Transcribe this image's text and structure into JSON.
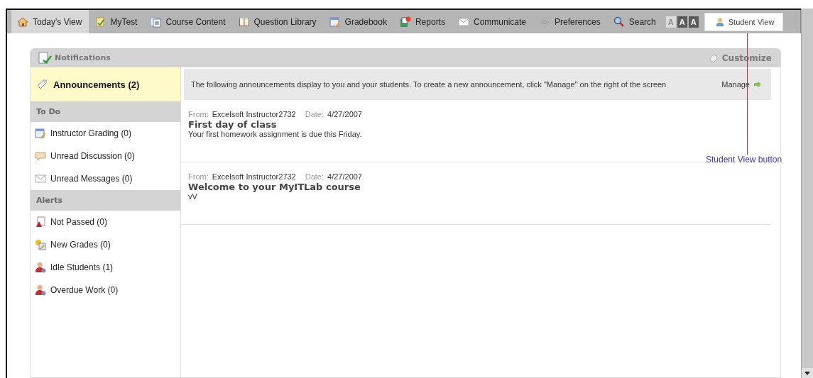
{
  "toolbar": {
    "tabs": [
      {
        "label": "Today's View",
        "selected": true
      },
      {
        "label": "MyTest",
        "selected": false
      },
      {
        "label": "Course Content",
        "selected": false
      },
      {
        "label": "Question Library",
        "selected": false
      },
      {
        "label": "Gradebook",
        "selected": false
      },
      {
        "label": "Reports",
        "selected": false
      },
      {
        "label": "Communicate",
        "selected": false
      },
      {
        "label": "Preferences",
        "selected": false
      },
      {
        "label": "Search",
        "selected": false
      }
    ],
    "text_sizes": [
      {
        "label": "A",
        "disabled": true
      },
      {
        "label": "A",
        "disabled": false
      },
      {
        "label": "A",
        "disabled": false
      }
    ],
    "student_view": {
      "label": "Student View"
    }
  },
  "panel": {
    "title": "Notifications",
    "customize": "Customize",
    "sidebar": [
      {
        "kind": "item",
        "label": "Announcements (2)",
        "selected": true
      },
      {
        "kind": "header",
        "label": "To Do"
      },
      {
        "kind": "item",
        "label": "Instructor Grading (0)",
        "selected": false
      },
      {
        "kind": "item",
        "label": "Unread Discussion (0)",
        "selected": false
      },
      {
        "kind": "item",
        "label": "Unread Messages (0)",
        "selected": false
      },
      {
        "kind": "header",
        "label": "Alerts"
      },
      {
        "kind": "item",
        "label": "Not Passed (0)",
        "selected": false
      },
      {
        "kind": "item",
        "label": "New Grades (0)",
        "selected": false
      },
      {
        "kind": "item",
        "label": "Idle Students (1)",
        "selected": false
      },
      {
        "kind": "item",
        "label": "Overdue Work (0)",
        "selected": false
      }
    ],
    "info": "The following announcements display to you and your students. To create a new announcement, click \"Manage\" on the right of the screen",
    "manage": "Manage",
    "announcements": [
      {
        "from_label": "From:",
        "from": "Excelsoft Instructor2732",
        "date_label": "Date:",
        "date": "4/27/2007",
        "title": "First day of class",
        "body": "Your first homework assignment is due this Friday."
      },
      {
        "from_label": "From:",
        "from": "Excelsoft Instructor2732",
        "date_label": "Date:",
        "date": "4/27/2007",
        "title": "Welcome to your MyITLab course",
        "body": "vV"
      }
    ]
  },
  "callout": {
    "label": "Student View button"
  }
}
